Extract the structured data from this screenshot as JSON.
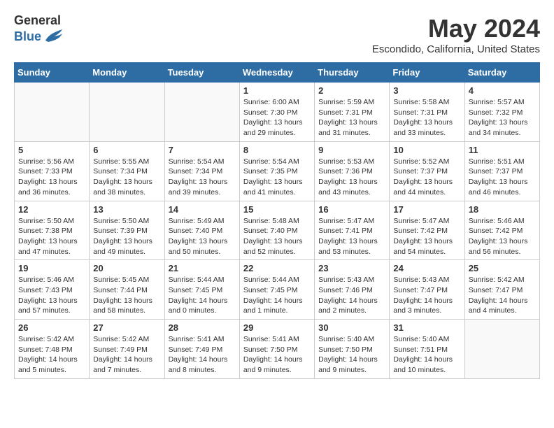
{
  "header": {
    "logo_general": "General",
    "logo_blue": "Blue",
    "month": "May 2024",
    "location": "Escondido, California, United States"
  },
  "days_of_week": [
    "Sunday",
    "Monday",
    "Tuesday",
    "Wednesday",
    "Thursday",
    "Friday",
    "Saturday"
  ],
  "weeks": [
    [
      {
        "day": "",
        "content": ""
      },
      {
        "day": "",
        "content": ""
      },
      {
        "day": "",
        "content": ""
      },
      {
        "day": "1",
        "content": "Sunrise: 6:00 AM\nSunset: 7:30 PM\nDaylight: 13 hours\nand 29 minutes."
      },
      {
        "day": "2",
        "content": "Sunrise: 5:59 AM\nSunset: 7:31 PM\nDaylight: 13 hours\nand 31 minutes."
      },
      {
        "day": "3",
        "content": "Sunrise: 5:58 AM\nSunset: 7:31 PM\nDaylight: 13 hours\nand 33 minutes."
      },
      {
        "day": "4",
        "content": "Sunrise: 5:57 AM\nSunset: 7:32 PM\nDaylight: 13 hours\nand 34 minutes."
      }
    ],
    [
      {
        "day": "5",
        "content": "Sunrise: 5:56 AM\nSunset: 7:33 PM\nDaylight: 13 hours\nand 36 minutes."
      },
      {
        "day": "6",
        "content": "Sunrise: 5:55 AM\nSunset: 7:34 PM\nDaylight: 13 hours\nand 38 minutes."
      },
      {
        "day": "7",
        "content": "Sunrise: 5:54 AM\nSunset: 7:34 PM\nDaylight: 13 hours\nand 39 minutes."
      },
      {
        "day": "8",
        "content": "Sunrise: 5:54 AM\nSunset: 7:35 PM\nDaylight: 13 hours\nand 41 minutes."
      },
      {
        "day": "9",
        "content": "Sunrise: 5:53 AM\nSunset: 7:36 PM\nDaylight: 13 hours\nand 43 minutes."
      },
      {
        "day": "10",
        "content": "Sunrise: 5:52 AM\nSunset: 7:37 PM\nDaylight: 13 hours\nand 44 minutes."
      },
      {
        "day": "11",
        "content": "Sunrise: 5:51 AM\nSunset: 7:37 PM\nDaylight: 13 hours\nand 46 minutes."
      }
    ],
    [
      {
        "day": "12",
        "content": "Sunrise: 5:50 AM\nSunset: 7:38 PM\nDaylight: 13 hours\nand 47 minutes."
      },
      {
        "day": "13",
        "content": "Sunrise: 5:50 AM\nSunset: 7:39 PM\nDaylight: 13 hours\nand 49 minutes."
      },
      {
        "day": "14",
        "content": "Sunrise: 5:49 AM\nSunset: 7:40 PM\nDaylight: 13 hours\nand 50 minutes."
      },
      {
        "day": "15",
        "content": "Sunrise: 5:48 AM\nSunset: 7:40 PM\nDaylight: 13 hours\nand 52 minutes."
      },
      {
        "day": "16",
        "content": "Sunrise: 5:47 AM\nSunset: 7:41 PM\nDaylight: 13 hours\nand 53 minutes."
      },
      {
        "day": "17",
        "content": "Sunrise: 5:47 AM\nSunset: 7:42 PM\nDaylight: 13 hours\nand 54 minutes."
      },
      {
        "day": "18",
        "content": "Sunrise: 5:46 AM\nSunset: 7:42 PM\nDaylight: 13 hours\nand 56 minutes."
      }
    ],
    [
      {
        "day": "19",
        "content": "Sunrise: 5:46 AM\nSunset: 7:43 PM\nDaylight: 13 hours\nand 57 minutes."
      },
      {
        "day": "20",
        "content": "Sunrise: 5:45 AM\nSunset: 7:44 PM\nDaylight: 13 hours\nand 58 minutes."
      },
      {
        "day": "21",
        "content": "Sunrise: 5:44 AM\nSunset: 7:45 PM\nDaylight: 14 hours\nand 0 minutes."
      },
      {
        "day": "22",
        "content": "Sunrise: 5:44 AM\nSunset: 7:45 PM\nDaylight: 14 hours\nand 1 minute."
      },
      {
        "day": "23",
        "content": "Sunrise: 5:43 AM\nSunset: 7:46 PM\nDaylight: 14 hours\nand 2 minutes."
      },
      {
        "day": "24",
        "content": "Sunrise: 5:43 AM\nSunset: 7:47 PM\nDaylight: 14 hours\nand 3 minutes."
      },
      {
        "day": "25",
        "content": "Sunrise: 5:42 AM\nSunset: 7:47 PM\nDaylight: 14 hours\nand 4 minutes."
      }
    ],
    [
      {
        "day": "26",
        "content": "Sunrise: 5:42 AM\nSunset: 7:48 PM\nDaylight: 14 hours\nand 5 minutes."
      },
      {
        "day": "27",
        "content": "Sunrise: 5:42 AM\nSunset: 7:49 PM\nDaylight: 14 hours\nand 7 minutes."
      },
      {
        "day": "28",
        "content": "Sunrise: 5:41 AM\nSunset: 7:49 PM\nDaylight: 14 hours\nand 8 minutes."
      },
      {
        "day": "29",
        "content": "Sunrise: 5:41 AM\nSunset: 7:50 PM\nDaylight: 14 hours\nand 9 minutes."
      },
      {
        "day": "30",
        "content": "Sunrise: 5:40 AM\nSunset: 7:50 PM\nDaylight: 14 hours\nand 9 minutes."
      },
      {
        "day": "31",
        "content": "Sunrise: 5:40 AM\nSunset: 7:51 PM\nDaylight: 14 hours\nand 10 minutes."
      },
      {
        "day": "",
        "content": ""
      }
    ]
  ]
}
